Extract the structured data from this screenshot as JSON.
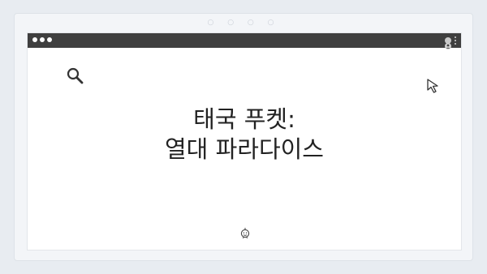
{
  "headline": {
    "line1": "태국 푸켓:",
    "line2": "열대 파라다이스"
  },
  "icons": {
    "frame_dots": "○ ○ ○ ○",
    "search": "search-icon",
    "cursor": "cursor-arrow-icon",
    "smiley": "smiley-icon",
    "user": "user-icon",
    "menu": "kebab-menu-icon"
  },
  "colors": {
    "titlebar": "#3f3f3f",
    "background": "#e8ecf1",
    "text": "#222222"
  }
}
